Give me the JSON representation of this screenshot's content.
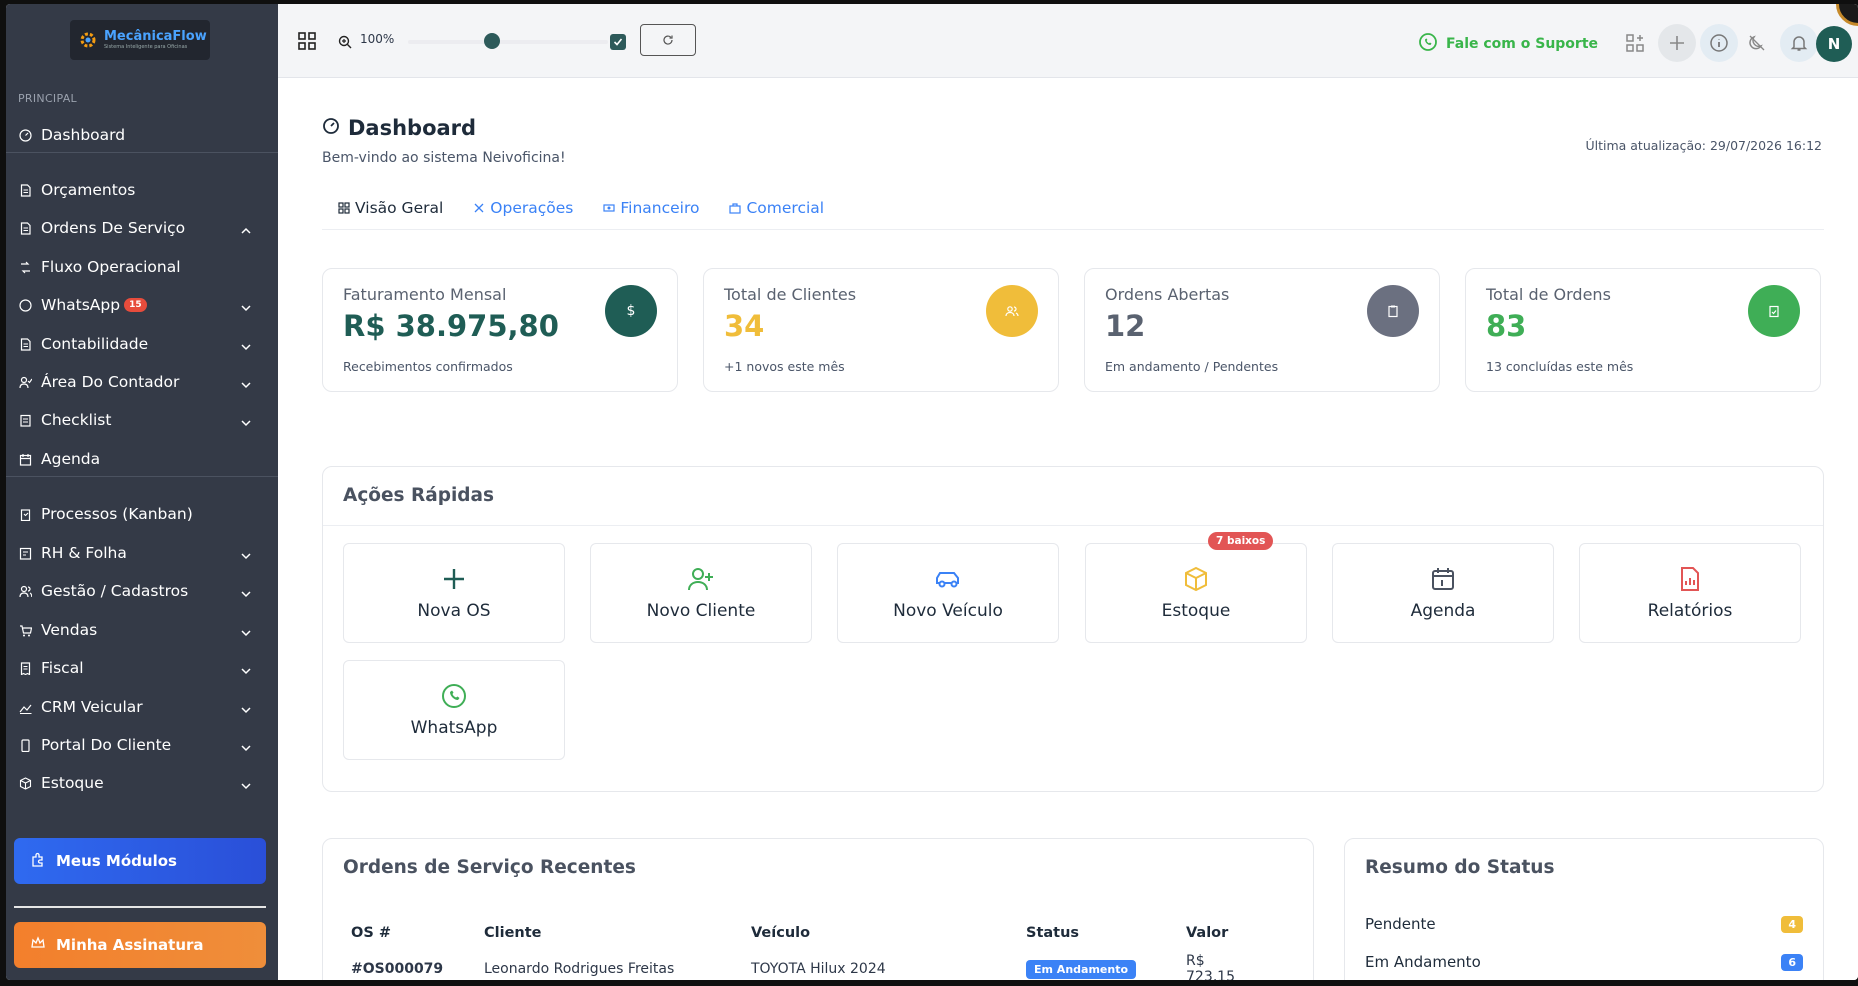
{
  "app": {
    "logo_name": "MecânicaFlow",
    "logo_sub": "Sistema Inteligente para Oficinas"
  },
  "sidebar": {
    "section": "PRINCIPAL",
    "items": [
      {
        "label": "Dashboard",
        "icon": "gauge-icon"
      },
      {
        "label": "Orçamentos",
        "icon": "document-icon"
      },
      {
        "label": "Ordens De Serviço",
        "icon": "document-icon",
        "expanded": true
      },
      {
        "label": "Fluxo Operacional",
        "icon": "flow-icon"
      },
      {
        "label": "WhatsApp",
        "icon": "whatsapp-icon",
        "badge": "15"
      },
      {
        "label": "Contabilidade",
        "icon": "document-icon"
      },
      {
        "label": "Área Do Contador",
        "icon": "user-check-icon"
      },
      {
        "label": "Checklist",
        "icon": "checklist-icon"
      },
      {
        "label": "Agenda",
        "icon": "calendar-icon"
      },
      {
        "label": "Processos (Kanban)",
        "icon": "clipboard-icon"
      },
      {
        "label": "RH & Folha",
        "icon": "id-card-icon"
      },
      {
        "label": "Gestão / Cadastros",
        "icon": "users-icon"
      },
      {
        "label": "Vendas",
        "icon": "cart-icon"
      },
      {
        "label": "Fiscal",
        "icon": "receipt-icon"
      },
      {
        "label": "CRM Veicular",
        "icon": "chart-icon"
      },
      {
        "label": "Portal Do Cliente",
        "icon": "mobile-icon"
      },
      {
        "label": "Estoque",
        "icon": "box-icon"
      }
    ],
    "modules_button": "Meus Módulos",
    "subscription_button": "Minha Assinatura"
  },
  "topbar": {
    "zoom": "100%",
    "zoom_level": 0.42,
    "support": "Fale com o Suporte",
    "avatar": "N"
  },
  "page": {
    "title": "Dashboard",
    "subtitle": "Bem-vindo ao sistema Neivoficina!",
    "last_update": "Última atualização: 29/07/2026 16:12"
  },
  "tabs": [
    "Visão Geral",
    "Operações",
    "Financeiro",
    "Comercial"
  ],
  "stats": [
    {
      "label": "Faturamento Mensal",
      "value": "R$ 38.975,80",
      "foot": "Recebimentos confirmados",
      "color": "#1f5d55",
      "icon": "dollar-icon"
    },
    {
      "label": "Total de Clientes",
      "value": "34",
      "foot": "+1 novos este mês",
      "color": "#f0bd3a",
      "icon": "users-icon"
    },
    {
      "label": "Ordens Abertas",
      "value": "12",
      "foot": "Em andamento / Pendentes",
      "color": "#6b7080",
      "icon": "clipboard-icon"
    },
    {
      "label": "Total de Ordens",
      "value": "83",
      "foot": "13 concluídas este mês",
      "color": "#3fae56",
      "icon": "clipboard-check-icon"
    }
  ],
  "quick_actions": {
    "title": "Ações Rápidas",
    "items": [
      {
        "label": "Nova OS",
        "icon": "plus-icon"
      },
      {
        "label": "Novo Cliente",
        "icon": "user-plus-icon"
      },
      {
        "label": "Novo Veículo",
        "icon": "car-icon"
      },
      {
        "label": "Estoque",
        "icon": "box-icon",
        "badge": "7 baixos"
      },
      {
        "label": "Agenda",
        "icon": "calendar-icon"
      },
      {
        "label": "Relatórios",
        "icon": "report-icon"
      },
      {
        "label": "WhatsApp",
        "icon": "whatsapp-icon"
      }
    ]
  },
  "recent_orders": {
    "title": "Ordens de Serviço Recentes",
    "columns": [
      "OS #",
      "Cliente",
      "Veículo",
      "Status",
      "Valor"
    ],
    "rows": [
      {
        "os": "#OS000079",
        "cliente": "Leonardo Rodrigues Freitas",
        "veiculo": "TOYOTA Hilux 2024",
        "status": "Em Andamento",
        "valor": "R$ 723,15"
      }
    ]
  },
  "status_summary": {
    "title": "Resumo do Status",
    "rows": [
      {
        "label": "Pendente",
        "count": "4",
        "color": "#f0bd3a"
      },
      {
        "label": "Em Andamento",
        "count": "6",
        "color": "#3b82f6"
      }
    ]
  }
}
